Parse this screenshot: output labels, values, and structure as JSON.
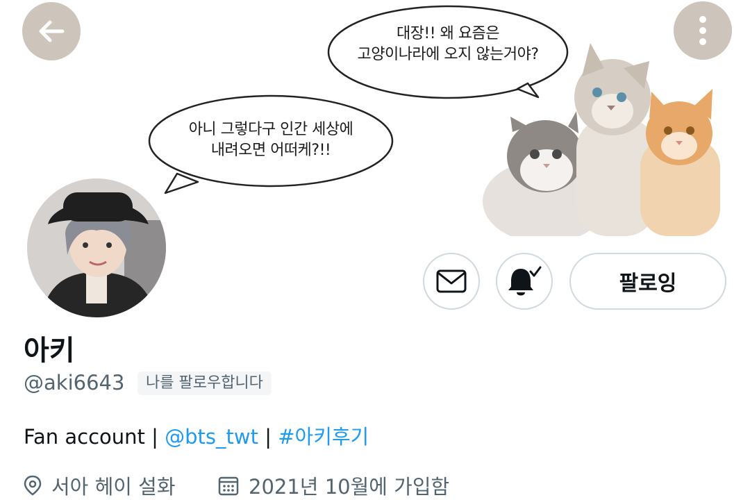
{
  "banner": {
    "bubble_top_line1": "대장!! 왜 요즘은",
    "bubble_top_line2": "고양이나라에 오지 않는거야?",
    "bubble_left_line1": "아니 그렇다구 인간 세상에",
    "bubble_left_line2": "내려오면 어떠케?!!"
  },
  "buttons": {
    "back_icon": "arrow-left-icon",
    "more_icon": "more-vertical-icon",
    "message_icon": "envelope-icon",
    "notify_icon": "bell-check-icon",
    "follow_label": "팔로잉"
  },
  "profile": {
    "name": "아키",
    "handle": "@aki6643",
    "follows_you": "나를 팔로우합니다",
    "bio_text": "Fan account | ",
    "bio_mention": "@bts_twt",
    "bio_sep": " | ",
    "bio_hashtag": "#아키후기",
    "location": "서아 헤이 설화",
    "joined": "2021년 10월에 가입함"
  },
  "colors": {
    "link": "#1d9bf0",
    "secondary": "#536471",
    "border": "#cfd9de"
  }
}
